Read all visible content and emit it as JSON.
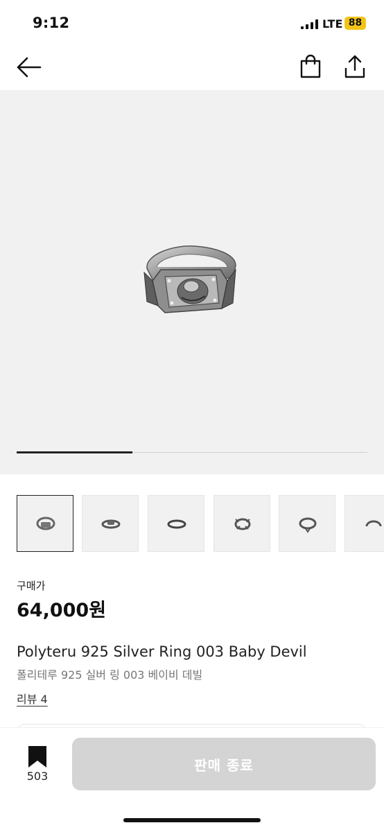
{
  "status_bar": {
    "time": "9:12",
    "network": "LTE",
    "battery": "88"
  },
  "nav": {
    "icons": [
      "back-arrow-icon",
      "shopping-bag-icon",
      "share-icon"
    ]
  },
  "gallery": {
    "progress": 0.33,
    "thumbnail_count": 6,
    "selected_index": 0
  },
  "price": {
    "label": "구매가",
    "value": "64,000원"
  },
  "product": {
    "name_en": "Polyteru 925 Silver Ring 003 Baby Devil",
    "name_ko": "폴리테루 925 실버 링 003 베이비 데빌",
    "review_link": "리뷰 4"
  },
  "bottom_bar": {
    "bookmark_count": "503",
    "buy_button_label": "판매 종료"
  },
  "colors": {
    "accent": "#111111",
    "button_disabled": "#d4d4d4",
    "battery": "#f2c418",
    "image_bg": "#f1f1f1"
  }
}
